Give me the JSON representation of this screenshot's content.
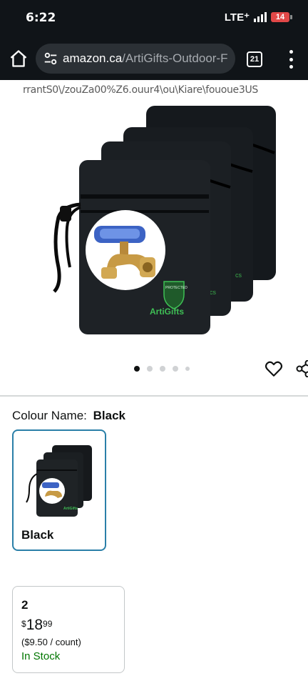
{
  "status_bar": {
    "time": "6:22",
    "network": "LTE⁺",
    "battery": "14"
  },
  "browser": {
    "url_domain": "amazon.ca",
    "url_path": "/ArtiGifts-Outdoor-F",
    "tab_count": "21"
  },
  "product_image": {
    "watermark_text": "rrantS0\\/zouZa00%Z6.ouur4\\ou\\Kiare\\fououe3US",
    "bag_brand": "ArtiGifts",
    "bag_badge": "PROTECTED",
    "carousel_dot_count": 5,
    "active_dot_index": 0
  },
  "variation": {
    "label": "Colour Name:",
    "value": "Black",
    "swatch_label": "Black"
  },
  "quantity_option": {
    "quantity": "2",
    "price_symbol": "$",
    "price_whole": "18",
    "price_fraction": "99",
    "unit_price": "($9.50 / count)",
    "stock": "In Stock"
  },
  "colors": {
    "status_bg": "#101418",
    "url_pill_bg": "#2b3035",
    "selected_border": "#2a7fa8",
    "in_stock": "#007600",
    "battery_low": "#e14848"
  }
}
